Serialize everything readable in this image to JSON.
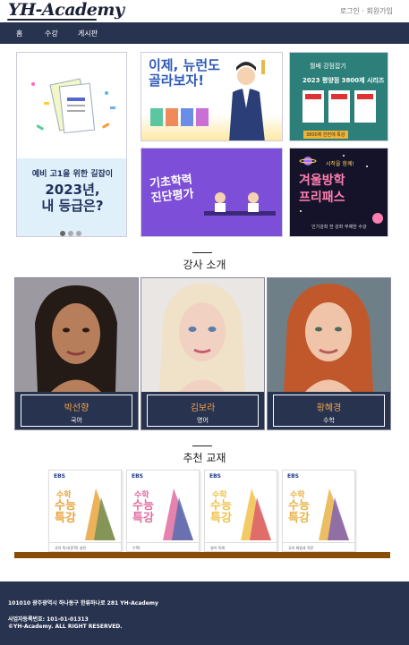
{
  "header": {
    "logo": "YH-Academy",
    "login": "로그인",
    "signup": "회원가입"
  },
  "nav": {
    "items": [
      "홈",
      "수강",
      "게시판"
    ]
  },
  "banners": {
    "main": {
      "line1": "예비 고1을 위한 길잡이",
      "line2a": "2023년,",
      "line2b": "내 등급은?"
    },
    "b2": {
      "title_a": "이제, 뉴런도",
      "title_b": "골라보자!"
    },
    "b3": {
      "tag": "월배 강점잡기",
      "title": "2023 평양점 3800제 시리즈",
      "footer": "3800제 한번에 특강"
    },
    "b4": {
      "title_a": "기초학력",
      "title_b": "진단평가"
    },
    "b5": {
      "tag": "시작을 함께!",
      "title_a": "겨울방학",
      "title_b": "프리패스",
      "footer": "인기강좌 전 강좌 무제한 수강"
    }
  },
  "teachers": {
    "heading": "강사 소개",
    "list": [
      {
        "name": "박선향",
        "subject": "국어"
      },
      {
        "name": "김보라",
        "subject": "영어"
      },
      {
        "name": "황혜경",
        "subject": "수학"
      }
    ]
  },
  "books": {
    "heading": "추천 교재",
    "brand": "EBS",
    "word1": "수학",
    "word2a": "수능",
    "word2b": "특강",
    "list": [
      {
        "caption": "국어 독서(문학) 실전",
        "colors": [
          "#e9a43c",
          "#6c8c56"
        ]
      },
      {
        "caption": "수학Ⅰ",
        "colors": [
          "#e06c9f",
          "#4c6bb2"
        ]
      },
      {
        "caption": "영어 독해",
        "colors": [
          "#f0c24b",
          "#d9566d"
        ]
      },
      {
        "caption": "국어 화법과 작문",
        "colors": [
          "#e8b348",
          "#7a5bb5"
        ]
      }
    ]
  },
  "footer": {
    "address": "101010 광주광역시 하나동구 한류하나로 281 YH-Academy",
    "biz": "사업자등록번호: 101-01-01313",
    "copy": "©YH-Academy. ALL RIGHT RESERVED."
  },
  "colors": {
    "navy": "#283350",
    "accent": "#f0a24a",
    "shelf": "#8a4d07"
  }
}
